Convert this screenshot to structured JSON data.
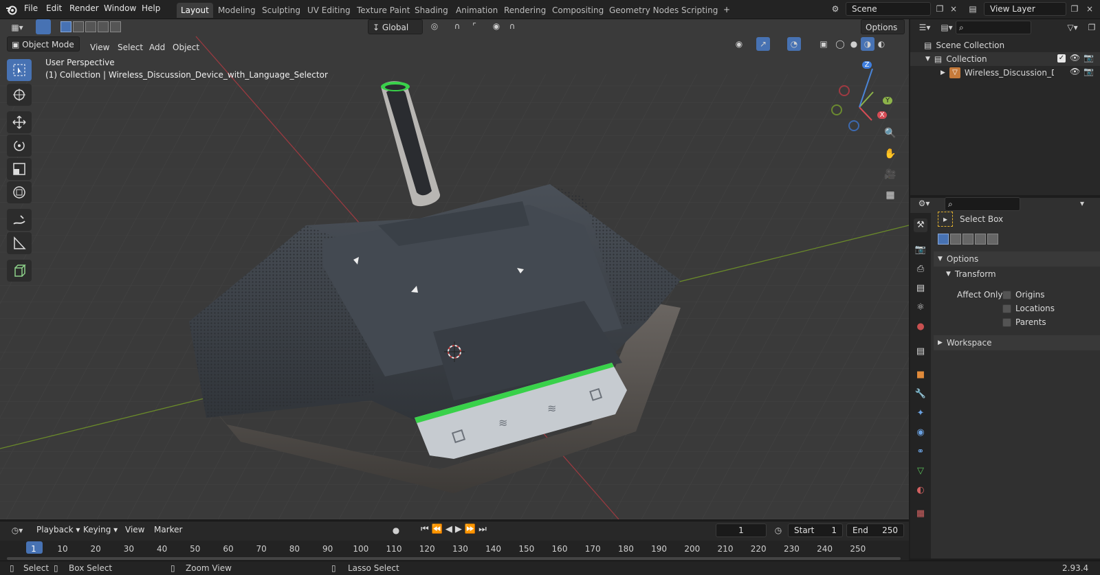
{
  "app": {
    "version": "2.93.4"
  },
  "topbar": {
    "menus": [
      "File",
      "Edit",
      "Render",
      "Window",
      "Help"
    ],
    "workspaces": [
      "Layout",
      "Modeling",
      "Sculpting",
      "UV Editing",
      "Texture Paint",
      "Shading",
      "Animation",
      "Rendering",
      "Compositing",
      "Geometry Nodes",
      "Scripting"
    ],
    "active_workspace": "Layout",
    "scene_name": "Scene",
    "view_layer": "View Layer"
  },
  "viewport": {
    "mode": "Object Mode",
    "menus": [
      "View",
      "Select",
      "Add",
      "Object"
    ],
    "transform_orientation": "Global",
    "options_label": "Options",
    "overlay_line1": "User Perspective",
    "overlay_line2": "(1) Collection | Wireless_Discussion_Device_with_Language_Selector",
    "gizmo": {
      "z": "Z",
      "y": "Y",
      "x": "X"
    },
    "accent_color": "#4772b3",
    "device_glow_color": "#39d14a"
  },
  "outliner": {
    "root": "Scene Collection",
    "collection": "Collection",
    "object": "Wireless_Discussion_Dev"
  },
  "properties": {
    "tool_name": "Select Box",
    "panel_options": "Options",
    "sub_transform": "Transform",
    "affect_only_label": "Affect Only",
    "checkboxes": [
      "Origins",
      "Locations",
      "Parents"
    ],
    "panel_workspace": "Workspace"
  },
  "timeline": {
    "menus": [
      "Playback",
      "Keying",
      "View",
      "Marker"
    ],
    "current_frame": "1",
    "start_label": "Start",
    "start_value": "1",
    "end_label": "End",
    "end_value": "250",
    "ticks": [
      "1",
      "10",
      "20",
      "30",
      "40",
      "50",
      "60",
      "70",
      "80",
      "90",
      "100",
      "110",
      "120",
      "130",
      "140",
      "150",
      "160",
      "170",
      "180",
      "190",
      "200",
      "210",
      "220",
      "230",
      "240",
      "250"
    ]
  },
  "statusbar": {
    "select": "Select",
    "box_select": "Box Select",
    "zoom_view": "Zoom View",
    "lasso_select": "Lasso Select"
  }
}
